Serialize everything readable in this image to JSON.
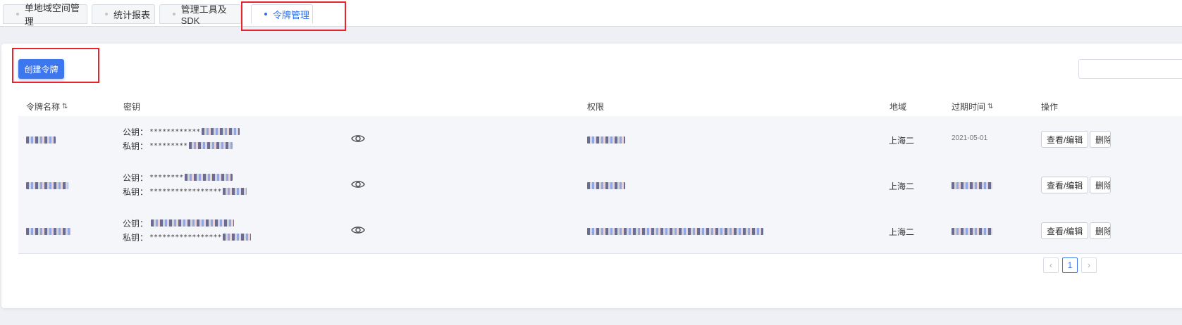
{
  "tabs": [
    {
      "label": "单地域空间管理",
      "active": false
    },
    {
      "label": "统计报表",
      "active": false
    },
    {
      "label": "管理工具及SDK",
      "active": false
    },
    {
      "label": "令牌管理",
      "active": true
    }
  ],
  "toolbar": {
    "create_label": "创建令牌",
    "search_placeholder": ""
  },
  "table": {
    "headers": {
      "name": "令牌名称",
      "key": "密钥",
      "permission": "权限",
      "region": "地域",
      "expire": "过期时间",
      "ops": "操作"
    },
    "public_key_label": "公钥：",
    "private_key_label": "私钥：",
    "rows": [
      {
        "public_key": "************",
        "private_key": "*********",
        "region": "上海二",
        "expire": "2021-05-01",
        "edit_label": "查看/编辑",
        "delete_label": "删除"
      },
      {
        "public_key": "********",
        "private_key": "*****************",
        "region": "上海二",
        "expire": "",
        "edit_label": "查看/编辑",
        "delete_label": "删除"
      },
      {
        "public_key": "",
        "private_key": "*****************",
        "region": "上海二",
        "expire": "",
        "edit_label": "查看/编辑",
        "delete_label": "删除"
      }
    ]
  },
  "pagination": {
    "prev": "‹",
    "current": "1",
    "next": "›"
  },
  "colors": {
    "accent": "#3d77ee",
    "highlight": "#e8232b"
  }
}
